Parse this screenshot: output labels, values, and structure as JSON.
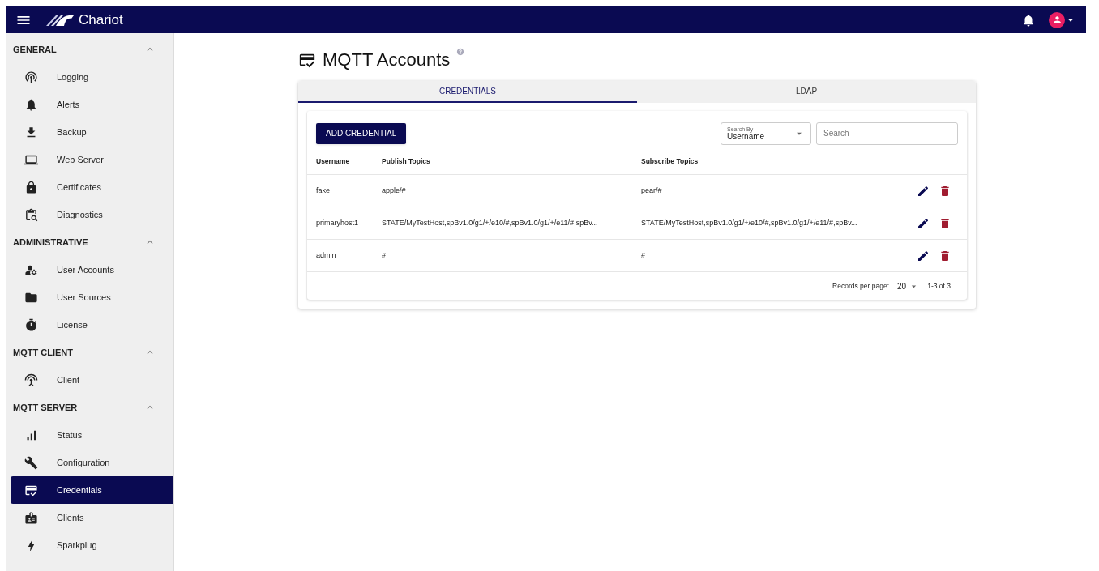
{
  "app_bar": {
    "title": "Chariot"
  },
  "sidebar": {
    "sections": [
      {
        "title": "GENERAL",
        "expanded": true,
        "items": [
          {
            "label": "Logging",
            "selected": false
          },
          {
            "label": "Alerts",
            "selected": false
          },
          {
            "label": "Backup",
            "selected": false
          },
          {
            "label": "Web Server",
            "selected": false
          },
          {
            "label": "Certificates",
            "selected": false
          },
          {
            "label": "Diagnostics",
            "selected": false
          }
        ]
      },
      {
        "title": "ADMINISTRATIVE",
        "expanded": true,
        "items": [
          {
            "label": "User Accounts",
            "selected": false
          },
          {
            "label": "User Sources",
            "selected": false
          },
          {
            "label": "License",
            "selected": false
          }
        ]
      },
      {
        "title": "MQTT CLIENT",
        "expanded": true,
        "items": [
          {
            "label": "Client",
            "selected": false
          }
        ]
      },
      {
        "title": "MQTT SERVER",
        "expanded": true,
        "items": [
          {
            "label": "Status",
            "selected": false
          },
          {
            "label": "Configuration",
            "selected": false
          },
          {
            "label": "Credentials",
            "selected": true
          },
          {
            "label": "Clients",
            "selected": false
          },
          {
            "label": "Sparkplug",
            "selected": false
          }
        ]
      }
    ]
  },
  "page": {
    "title": "MQTT Accounts"
  },
  "tabs": [
    {
      "label": "CREDENTIALS",
      "selected": true
    },
    {
      "label": "LDAP",
      "selected": false
    }
  ],
  "toolbar": {
    "add_button": "ADD CREDENTIAL",
    "search_by": {
      "label": "Search By",
      "value": "Username"
    },
    "search": {
      "placeholder": "Search"
    }
  },
  "table": {
    "columns": [
      "Username",
      "Publish Topics",
      "Subscribe Topics"
    ],
    "rows": [
      {
        "cells": [
          "fake",
          "apple/#",
          "pear/#"
        ]
      },
      {
        "cells": [
          "primaryhost1",
          "STATE/MyTestHost,spBv1.0/g1/+/e10/#,spBv1.0/g1/+/e11/#,spBv...",
          "STATE/MyTestHost,spBv1.0/g1/+/e10/#,spBv1.0/g1/+/e11/#,spBv..."
        ]
      },
      {
        "cells": [
          "admin",
          "#",
          "#"
        ]
      }
    ]
  },
  "pagination": {
    "label": "Records per page:",
    "per_page": "20",
    "range": "1-3 of 3"
  }
}
